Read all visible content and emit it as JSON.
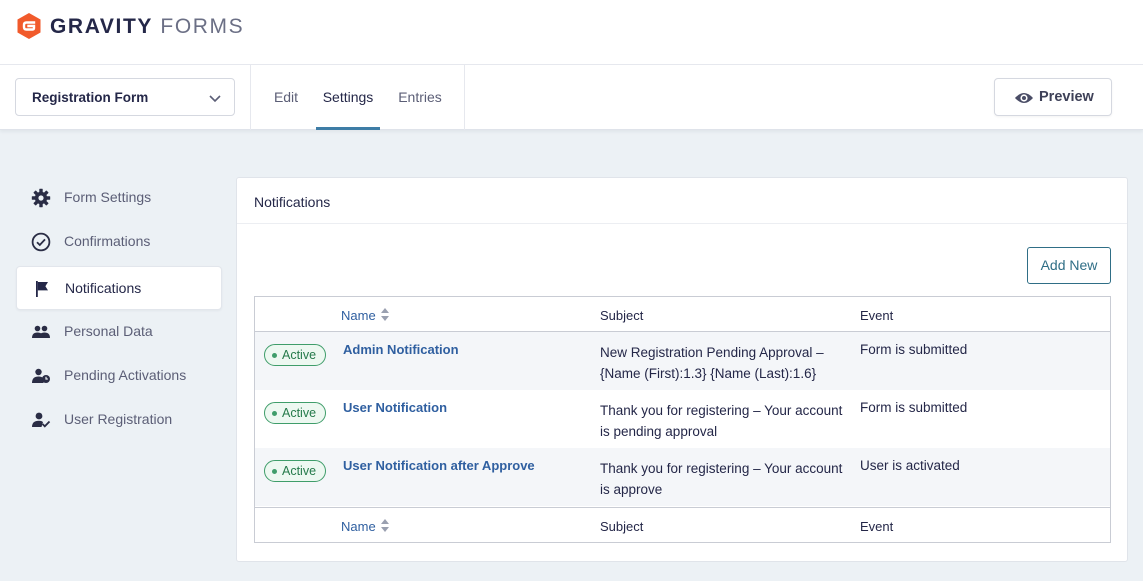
{
  "brand": {
    "strong": "GRAVITY",
    "light": "FORMS"
  },
  "toolbar": {
    "form_name": "Registration Form",
    "tabs": [
      {
        "label": "Edit",
        "active": false
      },
      {
        "label": "Settings",
        "active": true
      },
      {
        "label": "Entries",
        "active": false
      }
    ],
    "preview_label": "Preview"
  },
  "sidebar": {
    "items": [
      {
        "label": "Form Settings",
        "icon": "gear-icon",
        "active": false
      },
      {
        "label": "Confirmations",
        "icon": "check-circle-icon",
        "active": false
      },
      {
        "label": "Notifications",
        "icon": "flag-icon",
        "active": true
      },
      {
        "label": "Personal Data",
        "icon": "users-icon",
        "active": false
      },
      {
        "label": "Pending Activations",
        "icon": "user-clock-icon",
        "active": false
      },
      {
        "label": "User Registration",
        "icon": "user-check-icon",
        "active": false
      }
    ]
  },
  "panel": {
    "title": "Notifications",
    "add_new_label": "Add New",
    "columns": {
      "name": "Name",
      "subject": "Subject",
      "event": "Event"
    },
    "rows": [
      {
        "status": "Active",
        "name": "Admin Notification",
        "subject": "New Registration Pending Approval – {Name (First):1.3} {Name (Last):1.6}",
        "event": "Form is submitted"
      },
      {
        "status": "Active",
        "name": "User Notification",
        "subject": "Thank you for registering – Your account is pending approval",
        "event": "Form is submitted"
      },
      {
        "status": "Active",
        "name": "User Notification after Approve",
        "subject": "Thank you for registering – Your account is approve",
        "event": "User is activated"
      }
    ]
  },
  "colors": {
    "brand_orange": "#f15a2b",
    "accent_blue": "#3e7da6",
    "link_blue": "#2f5fa0",
    "active_green": "#3f9d6a",
    "text_dark": "#242748",
    "background": "#ecf1f5"
  }
}
